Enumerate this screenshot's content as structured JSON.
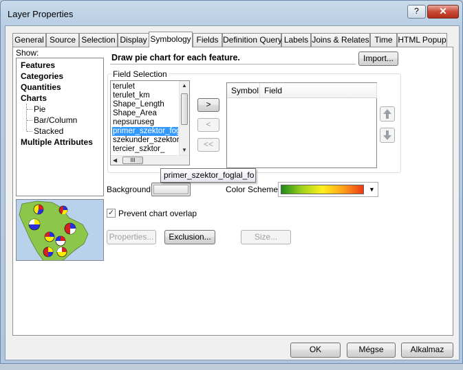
{
  "window": {
    "title": "Layer Properties",
    "help_label": "?",
    "close_label": "✕"
  },
  "tabs": [
    {
      "label": "General"
    },
    {
      "label": "Source"
    },
    {
      "label": "Selection"
    },
    {
      "label": "Display"
    },
    {
      "label": "Symbology",
      "active": true
    },
    {
      "label": "Fields"
    },
    {
      "label": "Definition Query"
    },
    {
      "label": "Labels"
    },
    {
      "label": "Joins & Relates"
    },
    {
      "label": "Time"
    },
    {
      "label": "HTML Popup"
    }
  ],
  "show": {
    "label": "Show:",
    "tree": {
      "features": "Features",
      "categories": "Categories",
      "quantities": "Quantities",
      "charts": "Charts",
      "pie": "Pie",
      "bar_column": "Bar/Column",
      "stacked": "Stacked",
      "multiple_attributes": "Multiple Attributes"
    }
  },
  "symbology": {
    "description": "Draw pie chart for each feature.",
    "import_label": "Import...",
    "field_selection_title": "Field Selection",
    "fields": [
      "terulet",
      "terulet_km",
      "Shape_Length",
      "Shape_Area",
      "nepsuruseg",
      "primer_szektor_foglal_fo",
      "szekunder_szektor_",
      "tercier_szktor_"
    ],
    "selected_field_index": 5,
    "add_label": ">",
    "remove_label": "<",
    "remove_all_label": "<<",
    "table_headers": {
      "symbol": "Symbol",
      "field": "Field"
    },
    "tooltip": "primer_szektor_foglal_fo",
    "scroll_thumb_label": "III",
    "background_label": "Background:",
    "color_scheme_label": "Color Scheme:",
    "color_scheme_colors": [
      "#1e8a1a",
      "#9fd11b",
      "#fff01f",
      "#ffa21a",
      "#ee3a14"
    ],
    "prevent_overlap_label": "Prevent chart overlap",
    "prevent_overlap_checked": true,
    "properties_label": "Properties...",
    "exclusion_label": "Exclusion...",
    "size_label": "Size..."
  },
  "footer": {
    "ok_label": "OK",
    "cancel_label": "Mégse",
    "apply_label": "Alkalmaz"
  }
}
